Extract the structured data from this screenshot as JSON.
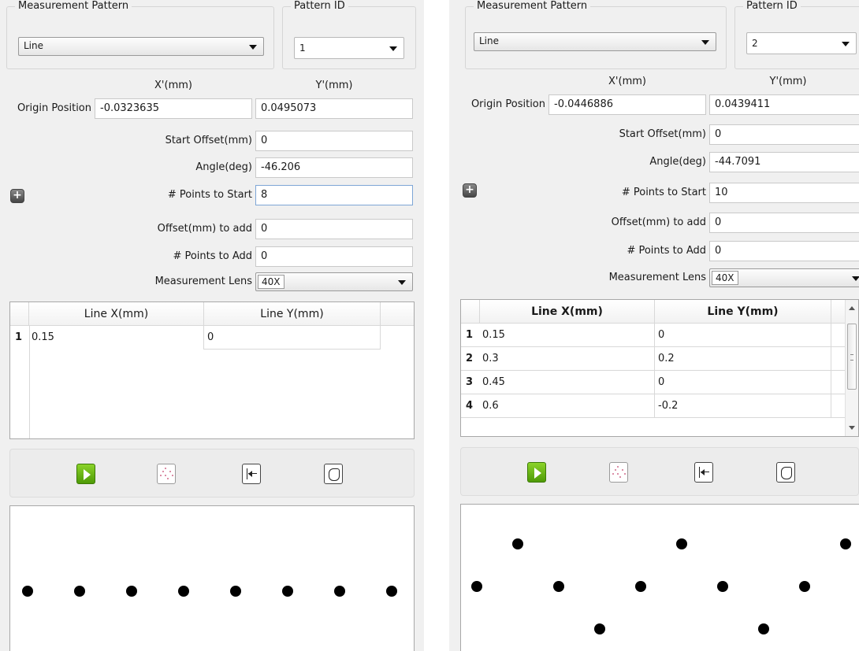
{
  "panels": [
    {
      "pattern_group_title": "Measurement Pattern",
      "pattern_value": "Line",
      "pattern_id_group_title": "Pattern ID",
      "pattern_id_value": "1",
      "x_col": "X'(mm)",
      "y_col": "Y'(mm)",
      "origin_label": "Origin Position",
      "origin_x": "-0.0323635",
      "origin_y": "0.0495073",
      "start_offset_label": "Start Offset(mm)",
      "start_offset": "0",
      "angle_label": "Angle(deg)",
      "angle": "-46.206",
      "points_start_label": "# Points to Start",
      "points_start": "8",
      "offset_add_label": "Offset(mm) to add",
      "offset_add": "0",
      "points_add_label": "# Points to Add",
      "points_add": "0",
      "lens_label": "Measurement Lens",
      "lens_value": "40X",
      "table": {
        "headers": [
          "Line X(mm)",
          "Line Y(mm)"
        ],
        "rows": [
          {
            "n": "1",
            "x": "0.15",
            "y": "0"
          }
        ]
      },
      "toolbar_icons": [
        "play-icon",
        "pattern-chart-icon",
        "go-to-start-icon",
        "outline-shape-icon"
      ],
      "preview_points": [
        0,
        0,
        0,
        0,
        0,
        0,
        0,
        0
      ]
    },
    {
      "pattern_group_title": "Measurement Pattern",
      "pattern_value": "Line",
      "pattern_id_group_title": "Pattern ID",
      "pattern_id_value": "2",
      "x_col": "X'(mm)",
      "y_col": "Y'(mm)",
      "origin_label": "Origin Position",
      "origin_x": "-0.0446886",
      "origin_y": "0.0439411",
      "start_offset_label": "Start Offset(mm)",
      "start_offset": "0",
      "angle_label": "Angle(deg)",
      "angle": "-44.7091",
      "points_start_label": "# Points to Start",
      "points_start": "10",
      "offset_add_label": "Offset(mm) to add",
      "offset_add": "0",
      "points_add_label": "# Points to Add",
      "points_add": "0",
      "lens_label": "Measurement Lens",
      "lens_value": "40X",
      "table": {
        "headers": [
          "Line X(mm)",
          "Line Y(mm)"
        ],
        "rows": [
          {
            "n": "1",
            "x": "0.15",
            "y": "0"
          },
          {
            "n": "2",
            "x": "0.3",
            "y": "0.2"
          },
          {
            "n": "3",
            "x": "0.45",
            "y": "0"
          },
          {
            "n": "4",
            "x": "0.6",
            "y": "-0.2"
          }
        ]
      },
      "toolbar_icons": [
        "play-icon",
        "pattern-chart-icon",
        "go-to-start-icon",
        "outline-shape-icon"
      ],
      "preview_points": [
        0,
        0.2,
        0,
        -0.2,
        0,
        0.2,
        0,
        -0.2,
        0,
        0.2
      ]
    }
  ]
}
